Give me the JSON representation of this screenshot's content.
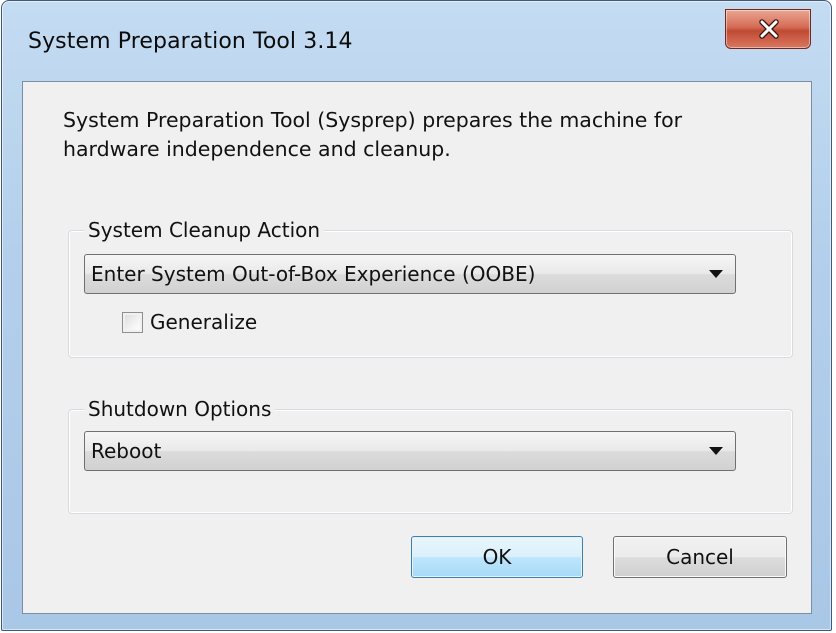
{
  "window": {
    "title": "System Preparation Tool 3.14",
    "close_glyph": "x"
  },
  "intro": {
    "text": "System Preparation Tool (Sysprep) prepares the machine for hardware independence and cleanup."
  },
  "cleanup": {
    "legend": "System Cleanup Action",
    "selected": "Enter System Out-of-Box Experience (OOBE)",
    "generalize_label": "Generalize",
    "generalize_checked": false
  },
  "shutdown": {
    "legend": "Shutdown Options",
    "selected": "Reboot"
  },
  "buttons": {
    "ok_label": "OK",
    "cancel_label": "Cancel"
  },
  "icons": {
    "close": "close-icon",
    "dropdown": "chevron-down-icon",
    "checkbox": "checkbox-icon"
  },
  "colors": {
    "frame": "#b3cfeb",
    "close_button": "#c94f38",
    "default_button_border": "#3c7fb1"
  }
}
